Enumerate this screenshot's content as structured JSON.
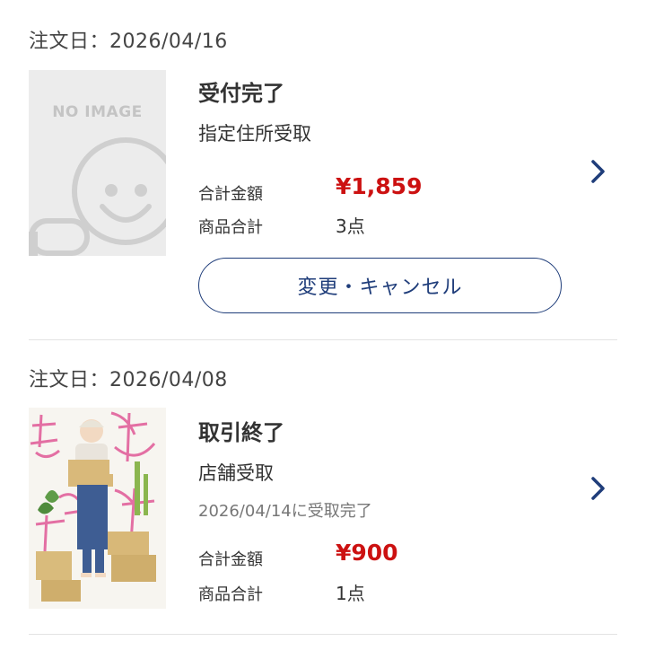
{
  "orders": [
    {
      "date_label": "注文日：2026/04/16",
      "thumbnail": {
        "type": "placeholder",
        "text": "NO IMAGE"
      },
      "status": "受付完了",
      "method": "指定住所受取",
      "total_label": "合計金額",
      "total": "¥1,859",
      "count_label": "商品合計",
      "count": "3点",
      "action_label": "変更・キャンセル",
      "chevron_icon": "chevron-right-icon"
    },
    {
      "date_label": "注文日：2026/04/08",
      "thumbnail": {
        "type": "book-cover"
      },
      "status": "取引終了",
      "method": "店舗受取",
      "received_note": "2026/04/14に受取完了",
      "total_label": "合計金額",
      "total": "¥900",
      "count_label": "商品合計",
      "count": "1点",
      "chevron_icon": "chevron-right-icon"
    }
  ],
  "colors": {
    "price": "#cc1111",
    "accent": "#1f3d7a",
    "divider": "#e3e3e3",
    "placeholder_bg": "#ececec"
  }
}
